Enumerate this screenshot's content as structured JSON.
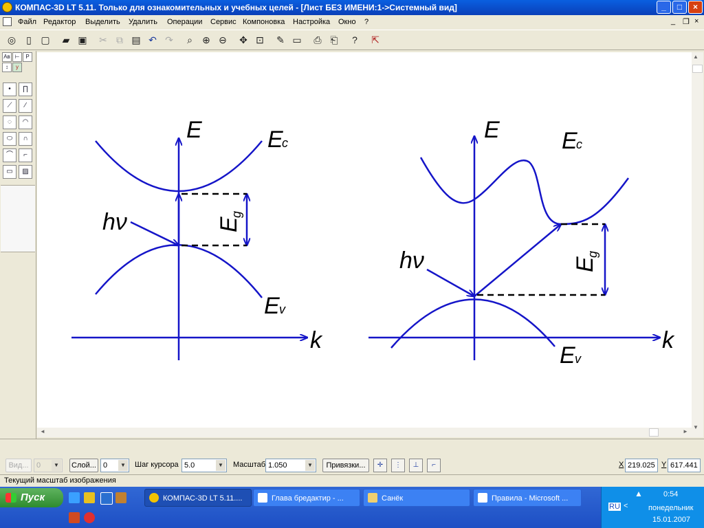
{
  "window": {
    "title": "КОМПАС-3D LT 5.11. Только для ознакомительных и учебных целей - [Лист БЕЗ ИМЕНИ:1->Системный вид]",
    "minimize": "_",
    "maximize": "□",
    "close": "×"
  },
  "menu": {
    "items": [
      "Файл",
      "Редактор",
      "Выделить",
      "Удалить",
      "Операции",
      "Сервис",
      "Компоновка",
      "Настройка",
      "Окно",
      "?"
    ],
    "mdi_minimize": "_",
    "mdi_restore": "❐",
    "mdi_close": "×"
  },
  "left_panel": {
    "tab_labels": [
      "Aв",
      "⊢",
      "P",
      "↕",
      "y"
    ]
  },
  "drawing": {
    "left": {
      "E": "E",
      "Ec": "E",
      "Ec_sub": "c",
      "Ev": "E",
      "Ev_sub": "v",
      "hv": "hν",
      "Eg": "E",
      "Eg_sub": "g",
      "k": "k"
    },
    "right": {
      "E": "E",
      "Ec": "E",
      "Ec_sub": "c",
      "Ev": "E",
      "Ev_sub": "v",
      "hv": "hν",
      "Eg": "E",
      "Eg_sub": "g",
      "k": "k"
    },
    "curve_color": "#1515c8"
  },
  "statusbar": {
    "view_button": "Вид...",
    "view_value": "0",
    "layer_button": "Слой...",
    "layer_value": "0",
    "cursor_step_label": "Шаг курсора",
    "cursor_step_value": "5.0",
    "scale_label": "Масштаб",
    "scale_value": "1.050",
    "snaps_button": "Привязки...",
    "x_label": "X",
    "x_value": "219.025",
    "y_label": "Y",
    "y_value": "617.441"
  },
  "hint": "Текущий масштаб изображения",
  "taskbar": {
    "start": "Пуск",
    "tasks": [
      "КОМПАС-3D LT 5.11....",
      "Глава бредактир - ...",
      "Санёк",
      "Правила - Microsoft ..."
    ],
    "lang": "RU",
    "time": "0:54",
    "day": "понедельник",
    "date": "15.01.2007"
  }
}
